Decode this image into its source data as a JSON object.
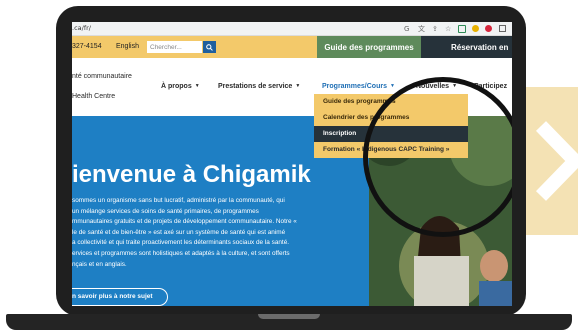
{
  "browser": {
    "url": ".ca/fr/",
    "icons": [
      "google-icon",
      "translate-icon",
      "share-icon",
      "star-icon",
      "extension-icon",
      "profile-icon",
      "menu-icon"
    ]
  },
  "topbar": {
    "phone": "327-4154",
    "language_link": "English",
    "search_placeholder": "Chercher...",
    "guide_button": "Guide des programmes",
    "reservation_button": "Réservation en"
  },
  "brand": {
    "line1": "nté communautaire",
    "line2": "Health Centre"
  },
  "nav": {
    "items": [
      {
        "label": "À propos"
      },
      {
        "label": "Prestations de service"
      },
      {
        "label": "Programmes/Cours"
      },
      {
        "label": "Nouvelles"
      },
      {
        "label": "Participez"
      }
    ]
  },
  "dropdown": {
    "items": [
      {
        "label": "Guide des programmes"
      },
      {
        "label": "Calendrier des programmes"
      },
      {
        "label": "Inscription"
      },
      {
        "label": "Formation « Indigenous CAPC Training »"
      }
    ]
  },
  "hero": {
    "title": "ienvenue à Chigamik",
    "body": [
      "sommes un organisme sans but lucratif, administré par la communauté, qui",
      "un mélange services de soins de santé primaires, de programmes",
      "mmunautaires gratuits et de projets de développement communautaire. Notre «",
      "le de santé et de bien-être » est axé sur un système de santé qui est animé",
      "a collectivité et qui traite proactivement les déterminants sociaux de la santé.",
      "ervices et programmes sont holistiques et adaptés à la culture, et sont offerts",
      "nçais et en anglais."
    ],
    "cta": "n savoir plus à notre sujet"
  },
  "colors": {
    "topbar": "#f3c96a",
    "guide_button": "#5e8a5b",
    "reservation_button": "#26323a",
    "hero_blue": "#1e7fc4",
    "nav_active": "#1f6fb5",
    "dropdown_selected": "#26323a",
    "decor_band": "#f4e2b4"
  }
}
